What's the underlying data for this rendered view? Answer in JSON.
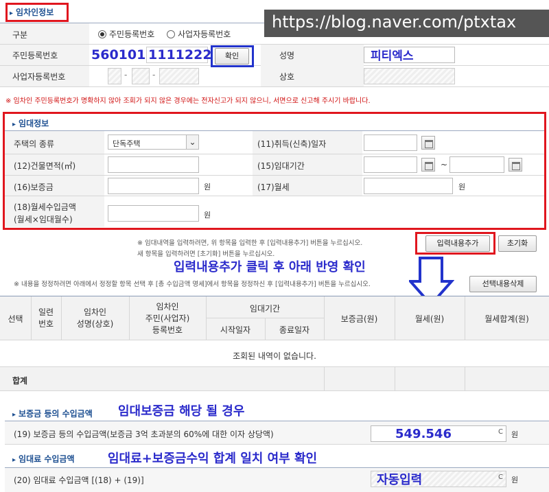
{
  "watermark": "https://blog.naver.com/ptxtax",
  "tenant": {
    "title": "임차인정보",
    "type_label": "구분",
    "radio_resident": "주민등록번호",
    "radio_business": "사업자등록번호",
    "resident_no_label": "주민등록번호",
    "resident_no_value": "560101",
    "resident_no_value2": "1111222",
    "confirm_label": "확인",
    "name_label": "성명",
    "name_value": "피티엑스",
    "business_no_label": "사업자등록번호",
    "company_label": "상호",
    "warning": "※ 임차인 주민등록번호가 명확하지 않아 조회가 되지 않은 경우에는 전자신고가 되지 않으니, 서면으로 신고해 주시기 바랍니다."
  },
  "lease": {
    "title": "임대정보",
    "house_type_label": "주택의 종류",
    "house_type_value": "단독주택",
    "acquire_date_label": "(11)취득(신축)일자",
    "area_label": "(12)건물면적(㎡)",
    "period_label": "(15)임대기간",
    "period_sep": "~",
    "deposit_label": "(16)보증금",
    "deposit_unit": "원",
    "monthly_label": "(17)월세",
    "monthly_unit": "원",
    "monthly_total_label1": "(18)월세수입금액",
    "monthly_total_label2": "(월세×임대월수)",
    "monthly_total_unit": "원"
  },
  "actions": {
    "note1": "※ 임대내역을 입력하려면, 위 항목을 입력한 후 [입력내용추가] 버튼을 누르십시오.",
    "note2": "새 항목을 입력하려면 [초기화] 버튼을 누르십시오.",
    "add_label": "입력내용추가",
    "reset_label": "초기화",
    "note3": "※ 내용을 정정하려면 아래에서 정정할 항목 선택 후 [총 수입금액 명세]에서 항목을 정정하신 후 [입력내용추가] 버튼을 누르십시오.",
    "delete_label": "선택내용삭제"
  },
  "annotations": {
    "a1": "입력내용추가 클릭 후 아래 반영 확인",
    "a2": "임대보증금 해당 될 경우",
    "a3": "임대료+보증금수익 합계 일치 여부 확인",
    "auto": "자동입력"
  },
  "table": {
    "col_select": "선택",
    "col_no1": "일련",
    "col_no2": "번호",
    "col_name1": "임차인",
    "col_name2": "성명(상호)",
    "col_id1": "임차인",
    "col_id2": "주민(사업자)",
    "col_id3": "등록번호",
    "col_period": "임대기간",
    "col_start": "시작일자",
    "col_end": "종료일자",
    "col_deposit": "보증금(원)",
    "col_monthly": "월세(원)",
    "col_monthly_total": "월세합계(원)",
    "empty": "조회된 내역이 없습니다.",
    "sum_label": "합계"
  },
  "income": {
    "deposit_title": "보증금 등의 수입금액",
    "deposit_row": "(19) 보증금 등의 수입금액(보증금 3억 초과분의 60%에 대한 이자 상당액)",
    "deposit_value": "549.546",
    "rent_title": "임대료 수입금액",
    "rent_row": "(20) 임대료 수입금액 [(18) + (19)]",
    "unit": "원",
    "c_mark": "C"
  }
}
